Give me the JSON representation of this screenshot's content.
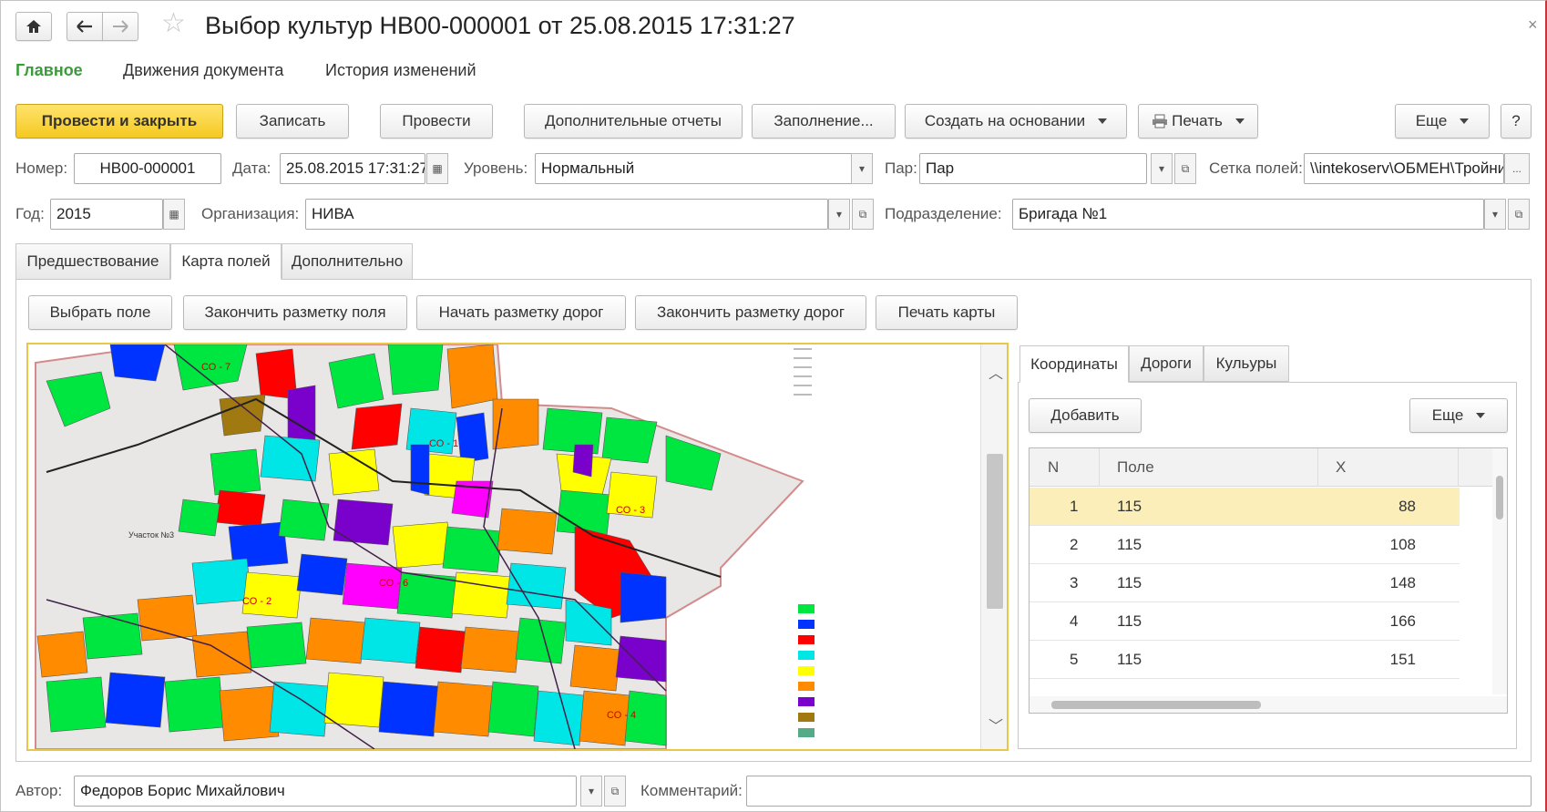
{
  "window": {
    "title": "Выбор культур НВ00-000001 от 25.08.2015 17:31:27"
  },
  "menu": [
    "Главное",
    "Движения документа",
    "История изменений"
  ],
  "toolbar": {
    "post_close": "Провести и закрыть",
    "save": "Записать",
    "post": "Провести",
    "reports": "Дополнительные отчеты",
    "fill": "Заполнение...",
    "create_based": "Создать на основании",
    "print": "Печать",
    "more": "Еще",
    "help": "?"
  },
  "form": {
    "number_label": "Номер:",
    "number": "НВ00-000001",
    "date_label": "Дата:",
    "date": "25.08.2015 17:31:27",
    "level_label": "Уровень:",
    "level": "Нормальный",
    "par_label": "Пар:",
    "par": "Пар",
    "grid_label": "Сетка полей:",
    "grid": "\\\\intekoserv\\ОБМЕН\\Тройни",
    "grid_btn": "...",
    "year_label": "Год:",
    "year": "2015",
    "org_label": "Организация:",
    "org": "НИВА",
    "division_label": "Подразделение:",
    "division": "Бригада №1"
  },
  "tabs": [
    "Предшествование",
    "Карта полей",
    "Дополнительно"
  ],
  "map_buttons": [
    "Выбрать поле",
    "Закончить разметку поля",
    "Начать разметку дорог",
    "Закончить разметку дорог",
    "Печать карты"
  ],
  "map_labels": [
    "СО - 7",
    "СО - 1",
    "СО - 3",
    "СО - 6",
    "СО - 2",
    "СО - 4",
    "Участок №3"
  ],
  "right_tabs": [
    "Координаты",
    "Дороги",
    "Кульуры"
  ],
  "grid_toolbar": {
    "add": "Добавить",
    "more": "Еще"
  },
  "table": {
    "columns": [
      "N",
      "Поле",
      "X"
    ],
    "rows": [
      {
        "n": "1",
        "field": "115",
        "x": "88"
      },
      {
        "n": "2",
        "field": "115",
        "x": "108"
      },
      {
        "n": "3",
        "field": "115",
        "x": "148"
      },
      {
        "n": "4",
        "field": "115",
        "x": "166"
      },
      {
        "n": "5",
        "field": "115",
        "x": "151"
      }
    ]
  },
  "footer": {
    "author_label": "Автор:",
    "author": "Федоров Борис Михайлович",
    "comment_label": "Комментарий:",
    "comment": ""
  },
  "colors": {
    "accent_green": "#3b9c3b",
    "primary_button": "#f5c922",
    "selected_row": "#fbeeb8",
    "frame_red": "#c8353a"
  }
}
